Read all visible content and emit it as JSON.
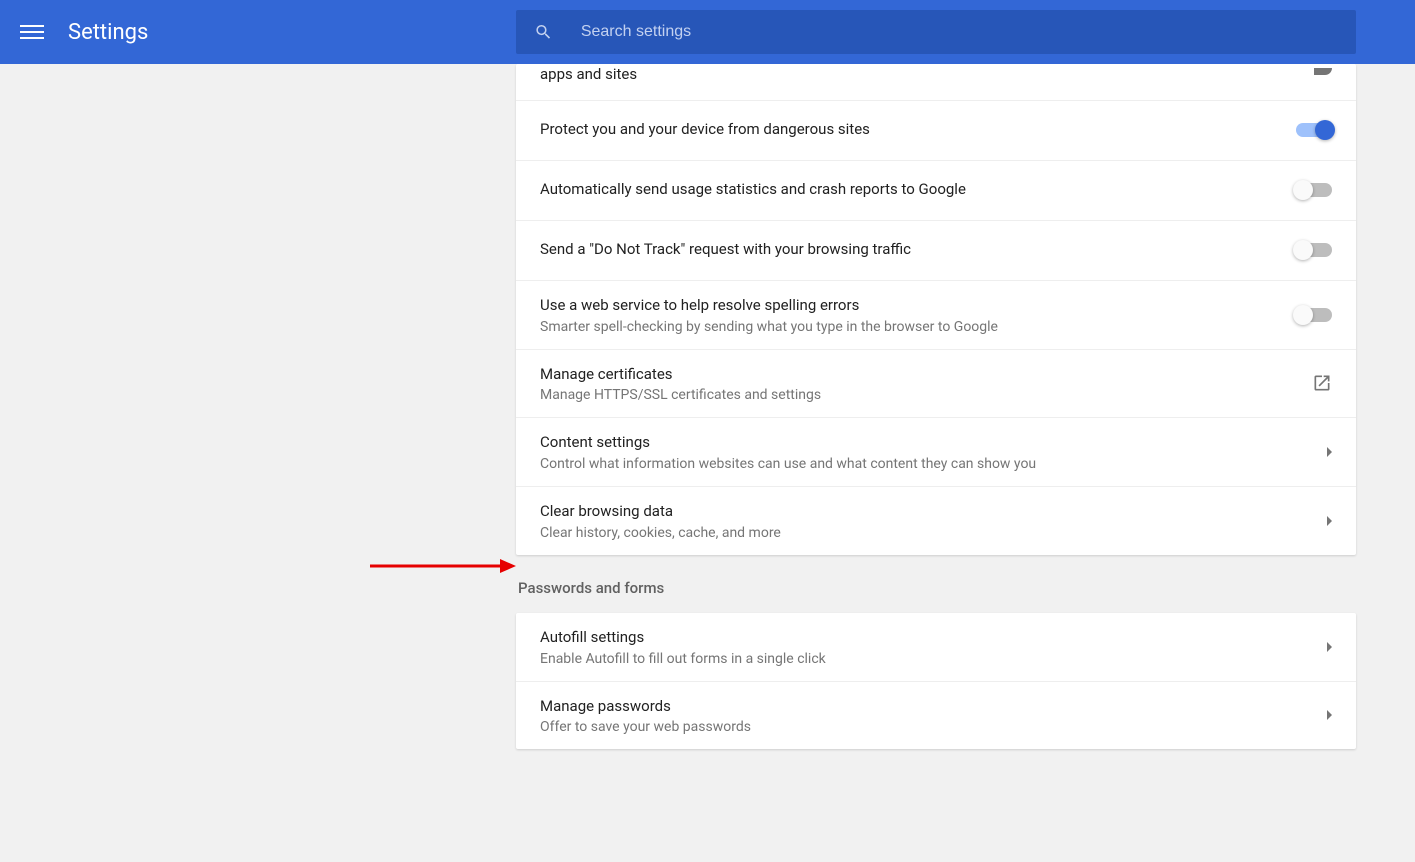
{
  "header": {
    "title": "Settings",
    "search_placeholder": "Search settings"
  },
  "privacy_section": {
    "rows": [
      {
        "title": "apps and sites",
        "toggle": "off-partial"
      },
      {
        "title": "Protect you and your device from dangerous sites",
        "toggle": "on"
      },
      {
        "title": "Automatically send usage statistics and crash reports to Google",
        "toggle": "off"
      },
      {
        "title": "Send a \"Do Not Track\" request with your browsing traffic",
        "toggle": "off"
      },
      {
        "title": "Use a web service to help resolve spelling errors",
        "sub": "Smarter spell-checking by sending what you type in the browser to Google",
        "toggle": "off"
      },
      {
        "title": "Manage certificates",
        "sub": "Manage HTTPS/SSL certificates and settings",
        "action": "external"
      },
      {
        "title": "Content settings",
        "sub": "Control what information websites can use and what content they can show you",
        "action": "arrow"
      },
      {
        "title": "Clear browsing data",
        "sub": "Clear history, cookies, cache, and more",
        "action": "arrow"
      }
    ]
  },
  "passwords_section": {
    "heading": "Passwords and forms",
    "rows": [
      {
        "title": "Autofill settings",
        "sub": "Enable Autofill to fill out forms in a single click",
        "action": "arrow"
      },
      {
        "title": "Manage passwords",
        "sub": "Offer to save your web passwords",
        "action": "arrow"
      }
    ]
  }
}
